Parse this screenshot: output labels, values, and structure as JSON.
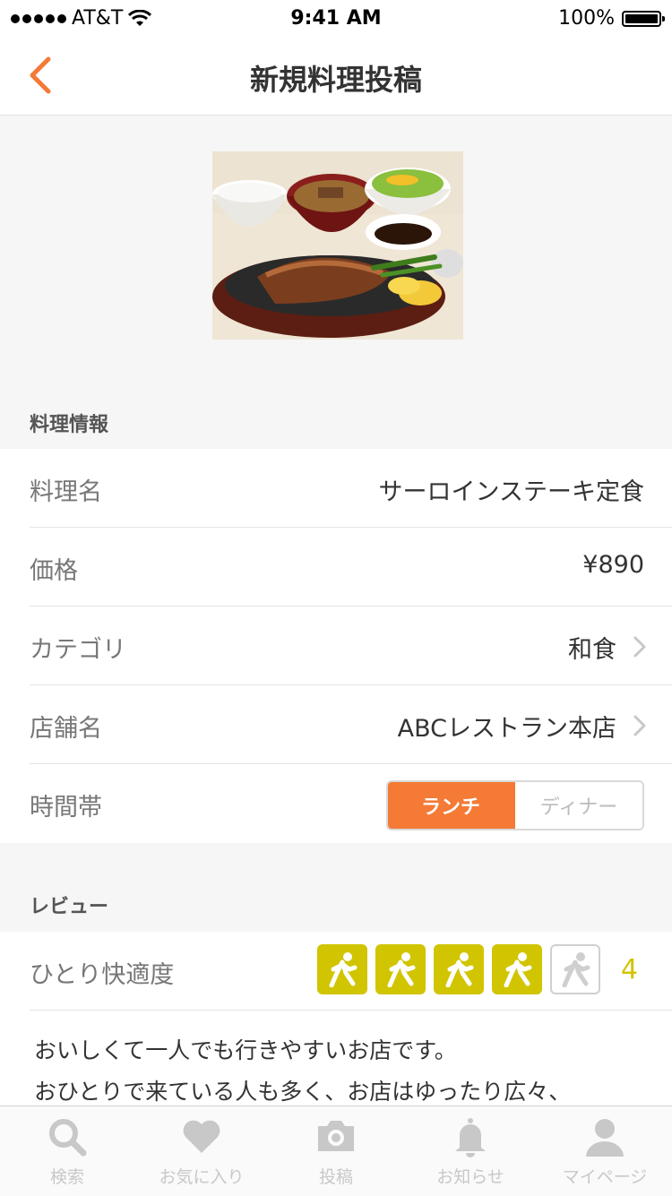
{
  "status_bar": {
    "carrier": "AT&T",
    "time": "9:41 AM",
    "battery": "100%"
  },
  "nav": {
    "title": "新規料理投稿",
    "back_icon": "chevron-left-icon",
    "accent": "#f47a36"
  },
  "photo": {
    "alt": "dish-photo"
  },
  "dish_info": {
    "header": "料理情報",
    "rows": {
      "name": {
        "label": "料理名",
        "value": "サーロインステーキ定食"
      },
      "price": {
        "label": "価格",
        "value": "¥890"
      },
      "category": {
        "label": "カテゴリ",
        "value": "和食"
      },
      "shop": {
        "label": "店舗名",
        "value": "ABCレストラン本店"
      },
      "time": {
        "label": "時間帯",
        "options": [
          "ランチ",
          "ディナー"
        ],
        "selected": "ランチ"
      }
    }
  },
  "review": {
    "header": "レビュー",
    "comfort": {
      "label": "ひとり快適度",
      "score": "4",
      "max": 5,
      "color": "#d1c400"
    },
    "text_line1": "おいしくて一人でも行きやすいお店です。",
    "text_line2": "おひとりで来ている人も多く、お店はゆったり広々、"
  },
  "tabbar": {
    "search": "検索",
    "favorites": "お気に入り",
    "post": "投稿",
    "notifications": "お知らせ",
    "mypage": "マイページ"
  }
}
